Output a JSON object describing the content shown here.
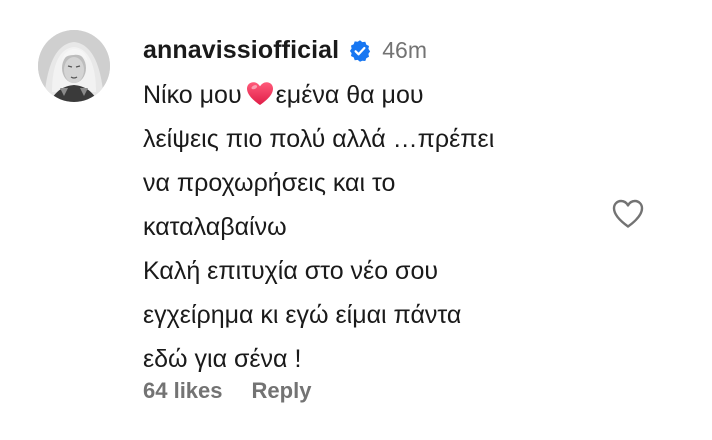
{
  "comment": {
    "username": "annavissiofficial",
    "timestamp": "46m",
    "verified_icon": "verified-badge-icon",
    "verified_color": "#1877f2",
    "emoji_icon": "heart-emoji-icon",
    "emoji_color": "#e8254a",
    "text_line_1_before": "Νίκο μου",
    "text_line_1_after": "εμένα θα μου",
    "text_line_2": "λείψεις πιο πολύ αλλά …πρέπει",
    "text_line_3": "να προχωρήσεις και το",
    "text_line_4": "καταλαβαίνω",
    "text_line_5": "Καλή επιτυχία στο νέο σου",
    "text_line_6": "εγχείρημα κι εγώ είμαι πάντα",
    "text_line_7": "εδώ για σένα !",
    "likes": "64 likes",
    "reply_label": "Reply",
    "like_icon": "heart-outline-icon"
  }
}
